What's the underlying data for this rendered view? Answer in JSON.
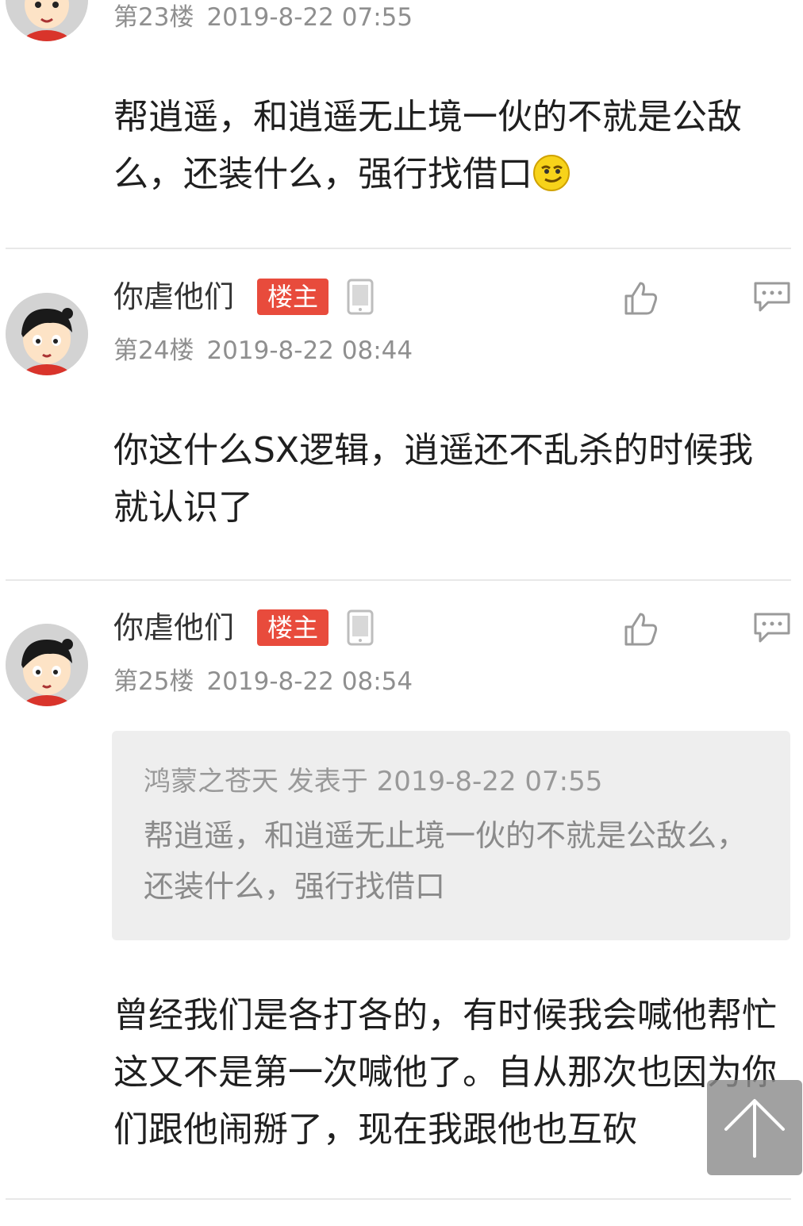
{
  "posts": [
    {
      "floor": "第23楼",
      "time": "2019-8-22 07:55",
      "content": "帮逍遥，和逍遥无止境一伙的不就是公敌么，还装什么，强行找借口"
    },
    {
      "username": "你虐他们",
      "badge": "楼主",
      "floor": "第24楼",
      "time": "2019-8-22 08:44",
      "content": "你这什么SX逻辑，逍遥还不乱杀的时候我就认识了"
    },
    {
      "username": "你虐他们",
      "badge": "楼主",
      "floor": "第25楼",
      "time": "2019-8-22 08:54",
      "quote": {
        "meta": "鸿蒙之苍天 发表于 2019-8-22 07:55",
        "text": "帮逍遥，和逍遥无止境一伙的不就是公敌么，还装什么，强行找借口"
      },
      "content": "曾经我们是各打各的，有时候我会喊他帮忙这又不是第一次喊他了。自从那次也因为你们跟他闹掰了，现在我跟他也互砍"
    }
  ],
  "icons": {
    "like": "thumbs-up-icon",
    "reply": "comment-icon",
    "device": "phone-icon",
    "back_to_top": "arrow-up-icon",
    "emoji": "smirk-emoji-icon"
  },
  "colors": {
    "badge": "#e84b3c",
    "meta_text": "#8f8f8f",
    "quote_bg": "#eeeeee"
  }
}
